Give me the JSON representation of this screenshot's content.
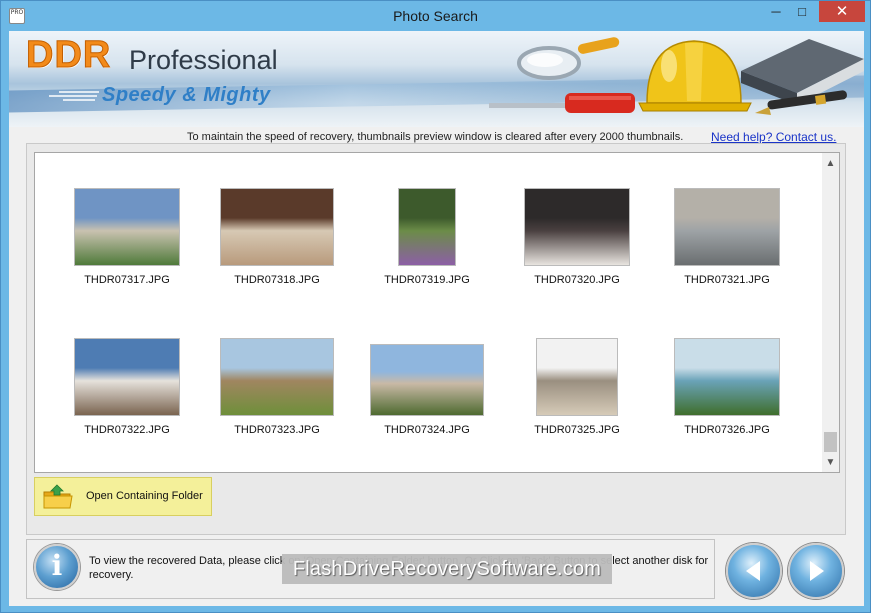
{
  "window": {
    "title": "Photo Search",
    "app_icon_text": "PRO",
    "controls": {
      "minimize": "─",
      "maximize": "□",
      "close": "✕"
    }
  },
  "banner": {
    "brand": "DDR",
    "edition": "Professional",
    "tagline": "Speedy & Mighty"
  },
  "notice": "To maintain the speed of recovery, thumbnails preview window is cleared after every 2000 thumbnails.",
  "help_link": "Need help? Contact us.",
  "thumbnails": [
    {
      "name": "THDR07317.JPG",
      "icon": "photo-house-garden",
      "colors": [
        "#6f94c4",
        "#4f7a3a",
        "#c9c2b0"
      ]
    },
    {
      "name": "THDR07318.JPG",
      "icon": "photo-dinner-party",
      "colors": [
        "#5a3a2a",
        "#b89a7c",
        "#d7c9b4"
      ]
    },
    {
      "name": "THDR07319.JPG",
      "icon": "photo-purple-flower",
      "colors": [
        "#3d5a2c",
        "#8c5fa6",
        "#6b8c48"
      ]
    },
    {
      "name": "THDR07320.JPG",
      "icon": "photo-group-exhibit",
      "colors": [
        "#2d2a2a",
        "#e8e4df",
        "#4a4040"
      ]
    },
    {
      "name": "THDR07321.JPG",
      "icon": "photo-street-cafe",
      "colors": [
        "#b4b0a8",
        "#6a6e70",
        "#9ea3a6"
      ]
    },
    {
      "name": "THDR07322.JPG",
      "icon": "photo-man-seaside",
      "colors": [
        "#4e7cb3",
        "#7a6450",
        "#e6e2dc"
      ]
    },
    {
      "name": "THDR07323.JPG",
      "icon": "photo-valley-path",
      "colors": [
        "#a8c6e0",
        "#6e8f3a",
        "#a08660"
      ]
    },
    {
      "name": "THDR07324.JPG",
      "icon": "photo-group-outdoor",
      "colors": [
        "#8fb6de",
        "#4e6a30",
        "#c9b9a6"
      ]
    },
    {
      "name": "THDR07325.JPG",
      "icon": "photo-apartment-building",
      "colors": [
        "#f2f2f2",
        "#d6cbb8",
        "#9a8f80"
      ]
    },
    {
      "name": "THDR07326.JPG",
      "icon": "photo-palm-pool",
      "colors": [
        "#c9dde8",
        "#3f6e2c",
        "#6aa3b8"
      ]
    }
  ],
  "open_folder_button": "Open Containing Folder",
  "footer_text": "To view the recovered Data, please click on 'Open Containing Folder' button. Or Click on 'Back' Button to select another disk for recovery.",
  "info_button": "i",
  "watermark": "FlashDriveRecoverySoftware.com"
}
